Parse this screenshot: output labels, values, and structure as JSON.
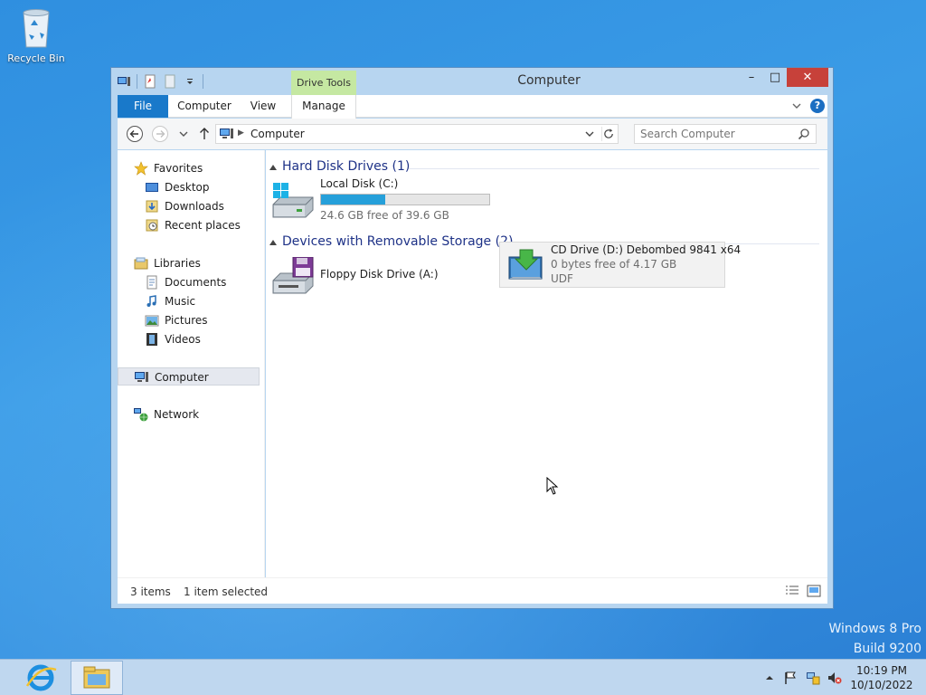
{
  "desktop": {
    "icons": [
      {
        "label": "Recycle Bin",
        "icon": "recycle-bin-icon"
      }
    ],
    "watermark": {
      "line1": "Windows 8 Pro",
      "line2": "Build 9200"
    }
  },
  "window": {
    "title": "Computer",
    "contextual_tab_group": "Drive Tools",
    "controls": {
      "minimize": "–",
      "maximize": "□",
      "close": "✕"
    },
    "ribbon_tabs": [
      "File",
      "Computer",
      "View",
      "Manage"
    ],
    "help_label": "?",
    "address": {
      "crumbs": [
        "Computer"
      ]
    },
    "search": {
      "placeholder": "Search Computer"
    },
    "nav_pane": {
      "favorites": {
        "label": "Favorites",
        "items": [
          "Desktop",
          "Downloads",
          "Recent places"
        ]
      },
      "libraries": {
        "label": "Libraries",
        "items": [
          "Documents",
          "Music",
          "Pictures",
          "Videos"
        ]
      },
      "computer": "Computer",
      "network": "Network"
    },
    "groups": [
      {
        "title": "Hard Disk Drives (1)",
        "items": [
          {
            "name": "Local Disk (C:)",
            "free_text": "24.6 GB free of 39.6 GB",
            "used_fraction": 0.38,
            "icon": "hard-drive-icon"
          }
        ]
      },
      {
        "title": "Devices with Removable Storage (2)",
        "items": [
          {
            "name": "Floppy Disk Drive (A:)",
            "icon": "floppy-drive-icon"
          },
          {
            "name": "CD Drive (D:) Debombed 9841 x64",
            "free_text": "0 bytes free of 4.17 GB",
            "fs": "UDF",
            "icon": "cd-drive-icon"
          }
        ]
      }
    ],
    "status": {
      "items": "3 items",
      "selected": "1 item selected"
    }
  },
  "taskbar": {
    "pinned": [
      {
        "icon": "internet-explorer-icon"
      },
      {
        "icon": "file-explorer-icon"
      }
    ],
    "clock": {
      "time": "10:19 PM",
      "date": "10/10/2022"
    }
  },
  "colors": {
    "accent": "#1979ca",
    "close": "#c7413a",
    "drive_bar": "#26a0da",
    "context_tab": "#c5e8a2"
  }
}
